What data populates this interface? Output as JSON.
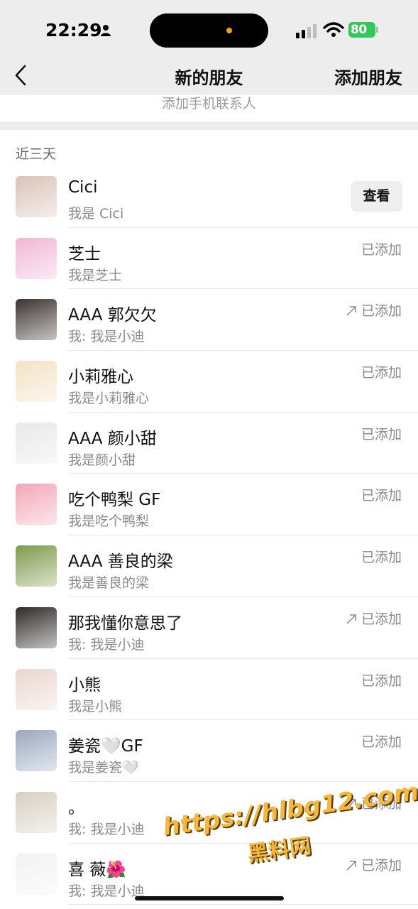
{
  "status_bar": {
    "time": "22:29",
    "battery": "80"
  },
  "nav": {
    "title": "新的朋友",
    "right_action": "添加朋友"
  },
  "add_contacts_label": "添加手机联系人",
  "section_label": "近三天",
  "rows": [
    {
      "name": "Cici",
      "message": "我是 Cici",
      "status": "",
      "button": "查看",
      "outgoing": false,
      "avatar_color": "#d9c3b8"
    },
    {
      "name": "芝士",
      "message": "我是芝士",
      "status": "已添加",
      "outgoing": false,
      "avatar_color": "#f1b6d6"
    },
    {
      "name": "AAA 郭欠欠",
      "message": "我: 我是小迪",
      "status": "已添加",
      "outgoing": true,
      "avatar_color": "#3b3330"
    },
    {
      "name": "小莉雅心",
      "message": "我是小莉雅心",
      "status": "已添加",
      "outgoing": false,
      "avatar_color": "#f3e2c4"
    },
    {
      "name": "AAA 颜小甜",
      "message": "我是颜小甜",
      "status": "已添加",
      "outgoing": false,
      "avatar_color": "#e8e8e8"
    },
    {
      "name": "吃个鸭梨 GF",
      "message": "我是吃个鸭梨",
      "status": "已添加",
      "outgoing": false,
      "avatar_color": "#f3a7b7"
    },
    {
      "name": "AAA 善良的梁",
      "message": "我是善良的梁",
      "status": "已添加",
      "outgoing": false,
      "avatar_color": "#7e9a4c"
    },
    {
      "name": "那我懂你意思了",
      "message": "我: 我是小迪",
      "status": "已添加",
      "outgoing": true,
      "avatar_color": "#2e2a28"
    },
    {
      "name": "小熊",
      "message": "我是小熊",
      "status": "已添加",
      "outgoing": false,
      "avatar_color": "#ead7d0"
    },
    {
      "name": "姜瓷🤍GF",
      "message": "我是姜瓷🤍",
      "status": "已添加",
      "outgoing": false,
      "avatar_color": "#9aa9c0"
    },
    {
      "name": "。",
      "message": "我: 我是小迪",
      "status": "已添加",
      "outgoing": true,
      "avatar_color": "#d8cfc2"
    },
    {
      "name": "喜 薇🌺",
      "message": "我: 我是小迪",
      "status": "已添加",
      "outgoing": true,
      "avatar_color": "#f2f2f2"
    }
  ],
  "watermark": {
    "url": "https://hlbg12.com",
    "caption": "黑料网"
  }
}
